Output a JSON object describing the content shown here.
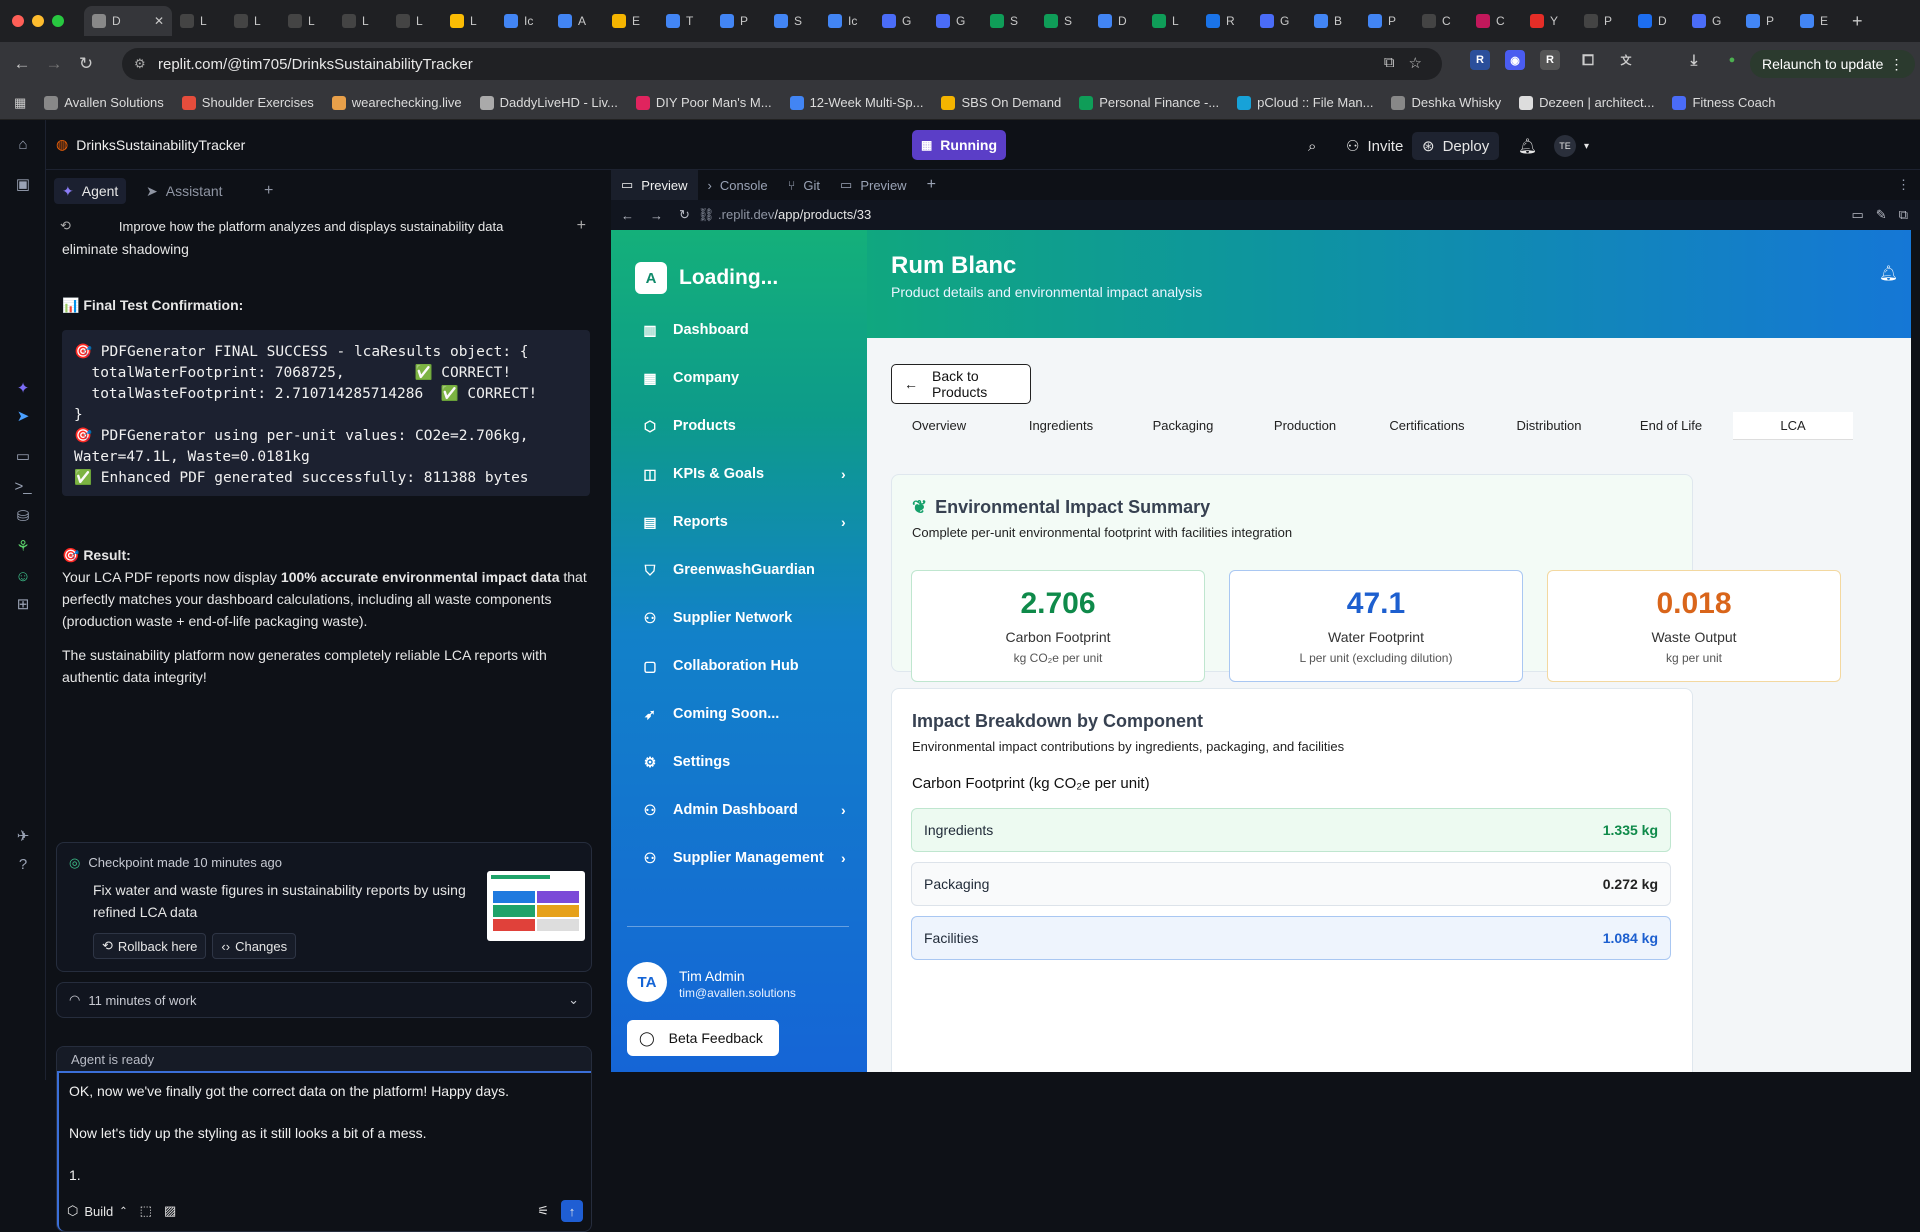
{
  "browser": {
    "tabs": [
      "D",
      "L",
      "L",
      "L",
      "L",
      "L",
      "L",
      "Ic",
      "A",
      "E",
      "T",
      "P",
      "S",
      "Ic",
      "G",
      "G",
      "S",
      "S",
      "D",
      "L",
      "R",
      "G",
      "B",
      "P",
      "C",
      "C",
      "Y",
      "P",
      "D",
      "G",
      "P",
      "E"
    ],
    "tab_colors": [
      "#888",
      "#444",
      "#444",
      "#444",
      "#444",
      "#444",
      "#fbbc04",
      "#4285f4",
      "#4285f4",
      "#f4b400",
      "#4285f4",
      "#4285f4",
      "#4285f4",
      "#4285f4",
      "#4a6cf7",
      "#4a6cf7",
      "#0f9d58",
      "#0f9d58",
      "#4285f4",
      "#0f9d58",
      "#1a73e8",
      "#4a6cf7",
      "#4285f4",
      "#4285f4",
      "#444",
      "#c2185b",
      "#e52d27",
      "#444",
      "#1d6ef0",
      "#4a6cf7",
      "#4285f4",
      "#4285f4"
    ],
    "url": "replit.com/@tim705/DrinksSustainabilityTracker",
    "relaunch": "Relaunch to update",
    "bookmarks": [
      "Avallen Solutions",
      "Shoulder Exercises",
      "wearechecking.live",
      "DaddyLiveHD - Liv...",
      "DIY Poor Man's M...",
      "12-Week Multi-Sp...",
      "SBS On Demand",
      "Personal Finance -...",
      "pCloud :: File Man...",
      "Deshka Whisky",
      "Dezeen | architect...",
      "Fitness Coach"
    ]
  },
  "replit": {
    "project": "DrinksSustainabilityTracker",
    "running": "Running",
    "invite": "Invite",
    "deploy": "Deploy",
    "avatar": "TE"
  },
  "agent": {
    "tab_agent": "Agent",
    "tab_assistant": "Assistant",
    "history_title": "Improve how the platform analyzes and displays sustainability data",
    "line0": "eliminate shadowing",
    "final_test": "📊 Final Test Confirmation:",
    "code": "🎯 PDFGenerator FINAL SUCCESS - lcaResults object: {\n  totalWaterFootprint: 7068725,        ✅ CORRECT!\n  totalWasteFootprint: 2.710714285714286  ✅ CORRECT!\n}\n🎯 PDFGenerator using per-unit values: CO2e=2.706kg,\nWater=47.1L, Waste=0.0181kg\n✅ Enhanced PDF generated successfully: 811388 bytes",
    "result_label": "🎯 Result:",
    "result_p1a": "Your LCA PDF reports now display ",
    "result_p1b": "100% accurate environmental impact data",
    "result_p1c": " that perfectly matches your dashboard calculations, including all waste components (production waste + end-of-life packaging waste).",
    "result_p2": "The sustainability platform now generates completely reliable LCA reports with authentic data integrity!",
    "checkpoint_meta": "Checkpoint made 10 minutes ago",
    "checkpoint_text": "Fix water and waste figures in sustainability reports by using refined LCA data",
    "rollback": "Rollback here",
    "changes": "Changes",
    "work": "11 minutes of work",
    "ready": "Agent is ready",
    "input": "OK, now we've finally got the correct data on the platform! Happy days.\n\nNow let's tidy up the styling as it still looks a bit of a mess.\n\n1.",
    "build": "Build"
  },
  "preview": {
    "tabs": [
      "Preview",
      "Console",
      "Git",
      "Preview"
    ],
    "url_prefix": ".replit.dev",
    "url_path": "/app/products/33"
  },
  "app": {
    "logo_letter": "A",
    "brand": "Loading...",
    "nav": [
      {
        "label": "Dashboard",
        "icon": "chart-icon",
        "chevron": false
      },
      {
        "label": "Company",
        "icon": "building-icon",
        "chevron": false
      },
      {
        "label": "Products",
        "icon": "box-icon",
        "chevron": false
      },
      {
        "label": "KPIs & Goals",
        "icon": "target-icon",
        "chevron": true
      },
      {
        "label": "Reports",
        "icon": "file-icon",
        "chevron": true
      },
      {
        "label": "GreenwashGuardian",
        "icon": "shield-icon",
        "chevron": false
      },
      {
        "label": "Supplier Network",
        "icon": "users-icon",
        "chevron": false
      },
      {
        "label": "Collaboration Hub",
        "icon": "chat-icon",
        "chevron": false
      },
      {
        "label": "Coming Soon...",
        "icon": "rocket-icon",
        "chevron": false
      },
      {
        "label": "Settings",
        "icon": "gear-icon",
        "chevron": false
      },
      {
        "label": "Admin Dashboard",
        "icon": "users-icon",
        "chevron": true
      },
      {
        "label": "Supplier Management",
        "icon": "users-icon",
        "chevron": true
      }
    ],
    "user_initials": "TA",
    "user_name": "Tim Admin",
    "user_email": "tim@avallen.solutions",
    "beta": "Beta Feedback",
    "title": "Rum Blanc",
    "subtitle": "Product details and environmental impact analysis",
    "back": "Back to Products",
    "tabs": [
      "Overview",
      "Ingredients",
      "Packaging",
      "Production",
      "Certifications",
      "Distribution",
      "End of Life",
      "LCA"
    ],
    "summary_title": "Environmental Impact Summary",
    "summary_sub": "Complete per-unit environmental footprint with facilities integration",
    "stats": [
      {
        "value": "2.706",
        "label": "Carbon Footprint",
        "unit": "kg CO₂e per unit",
        "color": "#0f8a4a",
        "border": "#bfe6cf"
      },
      {
        "value": "47.1",
        "label": "Water Footprint",
        "unit": "L per unit (excluding dilution)",
        "color": "#1d5fcf",
        "border": "#a9c7f2"
      },
      {
        "value": "0.018",
        "label": "Waste Output",
        "unit": "kg per unit",
        "color": "#d9651a",
        "border": "#f3d8a0"
      }
    ],
    "breakdown_title": "Impact Breakdown by Component",
    "breakdown_sub": "Environmental impact contributions by ingredients, packaging, and facilities",
    "carbon_heading": "Carbon Footprint (kg CO₂e per unit)",
    "rows": [
      {
        "label": "Ingredients",
        "value": "1.335 kg",
        "bg": "#edfaf1",
        "border": "#bfe6cf",
        "vcolor": "#0f8a4a"
      },
      {
        "label": "Packaging",
        "value": "0.272 kg",
        "bg": "#f9fafb",
        "border": "#dde3ea",
        "vcolor": "#222"
      },
      {
        "label": "Facilities",
        "value": "1.084 kg",
        "bg": "#eef4fd",
        "border": "#a9c7f2",
        "vcolor": "#1d5fcf"
      }
    ]
  }
}
